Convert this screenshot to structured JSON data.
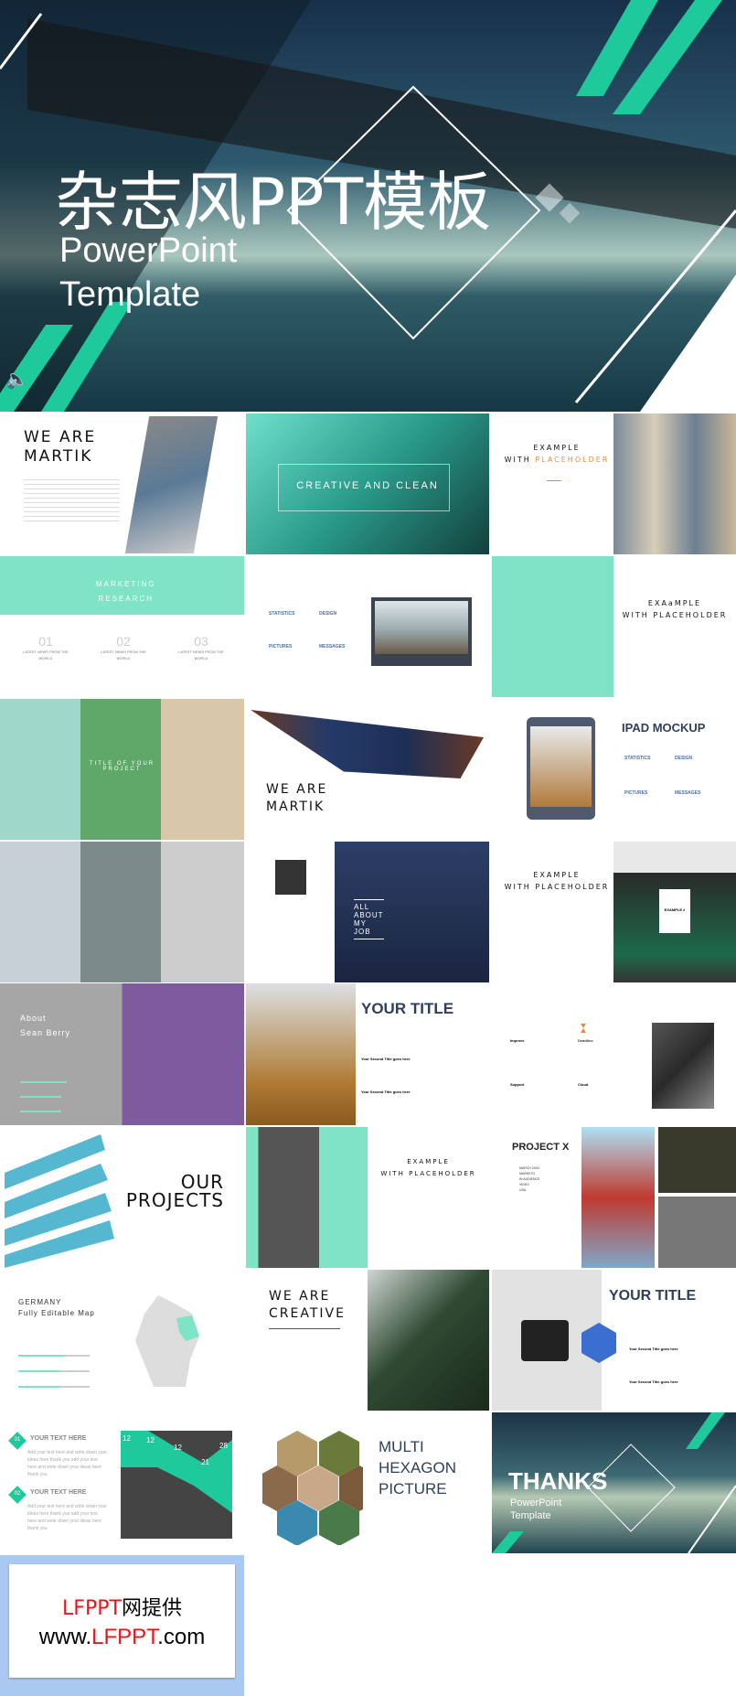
{
  "colors": {
    "accent": "#1ec99c",
    "mint": "#7fe3c5",
    "orange": "#f08a3a",
    "navy": "#2e3f5c",
    "red": "#e8141c",
    "footer_border": "#a9c8f2"
  },
  "hero": {
    "title_cn": "杂志风PPT模板",
    "subtitle_line1": "PowerPoint",
    "subtitle_line2": "Template",
    "icon": "speaker-icon"
  },
  "slides": {
    "we_are_martik": {
      "line1": "WE ARE",
      "line2": "MARTIK"
    },
    "creative_clean": {
      "title": "CREATIVE AND CLEAN"
    },
    "example1": {
      "line1": "EXAMPLE",
      "line2a": "WITH ",
      "line2b": "PLACEHOLDER"
    },
    "marketing": {
      "line1": "MARKETING",
      "line2": "RESEARCH",
      "items": [
        {
          "num": "01",
          "label": "LATEST NEWS FROM THE WORLD"
        },
        {
          "num": "02",
          "label": "LATEST NEWS FROM THE WORLD"
        },
        {
          "num": "03",
          "label": "LATEST NEWS FROM THE WORLD"
        }
      ]
    },
    "features": {
      "items": [
        "STATISTICS",
        "DESIGN",
        "PICTURES",
        "MESSAGES"
      ]
    },
    "example_a": {
      "line1": "EXAaMPLE",
      "line2": "WITH PLACEHOLDER"
    },
    "title_project": {
      "title": "TITLE OF YOUR PROJECT"
    },
    "we_are_martik2": {
      "line1": "WE ARE",
      "line2": "MARTIK"
    },
    "ipad": {
      "title": "IPAD MOCKUP",
      "items": [
        "STATISTICS",
        "DESIGN",
        "PICTURES",
        "MESSAGES"
      ]
    },
    "about_job": {
      "lines": [
        "ALL",
        "ABOUT",
        "MY",
        "JOB"
      ]
    },
    "example2": {
      "line1": "EXAMPLE",
      "line2": "WITH PLACEHOLDER",
      "card": "EXAMPLE 2"
    },
    "about": {
      "line1": "About",
      "line2": "Sean Berry"
    },
    "your_title": {
      "title": "YOUR TITLE",
      "sub1": "Your Second Title goes here",
      "sub2": "Your Second Title goes here"
    },
    "icons4": {
      "items": [
        "Improve",
        "Deadline",
        "Support",
        "Cloud"
      ]
    },
    "our_projects": {
      "line1": "OUR",
      "line2": "PROJECTS"
    },
    "example3": {
      "line1": "EXAMPLE",
      "line2": "WITH PLACEHOLDER"
    },
    "project_x": {
      "title": "PROJECT X",
      "rows": [
        "MARCH 2016",
        "MARKETO",
        "IN AUDIENCE",
        "VIDEO",
        "USA"
      ]
    },
    "germany": {
      "line1": "GERMANY",
      "line2": "Fully Editable Map"
    },
    "we_are_creative": {
      "line1": "WE ARE",
      "line2": "CREATIVE"
    },
    "your_title2": {
      "title": "YOUR TITLE",
      "sub1": "Your Second Title goes here",
      "sub2": "Your Second Title goes here"
    },
    "text_here": {
      "items": [
        {
          "num": "01",
          "title": "YOUR TEXT HERE",
          "body": "Add your text here and write down your ideas here thank you add your text here and write down your ideas here thank you"
        },
        {
          "num": "02",
          "title": "YOUR TEXT HERE",
          "body": "Add your text here and write down your ideas here thank you add your text here and write down your ideas here thank you"
        }
      ],
      "chart_values": [
        "12",
        "12",
        "12",
        "21",
        "28"
      ]
    },
    "hexagon": {
      "line1": "MULTI",
      "line2": "HEXAGON",
      "line3": "PICTURE"
    },
    "thanks": {
      "title": "THANKS",
      "line1": "PowerPoint",
      "line2": "Template"
    }
  },
  "footer": {
    "brand": "LFPPT",
    "cn": "网提供",
    "url_prefix": "www.",
    "url_brand": "LFPPT",
    "url_suffix": ".com"
  }
}
